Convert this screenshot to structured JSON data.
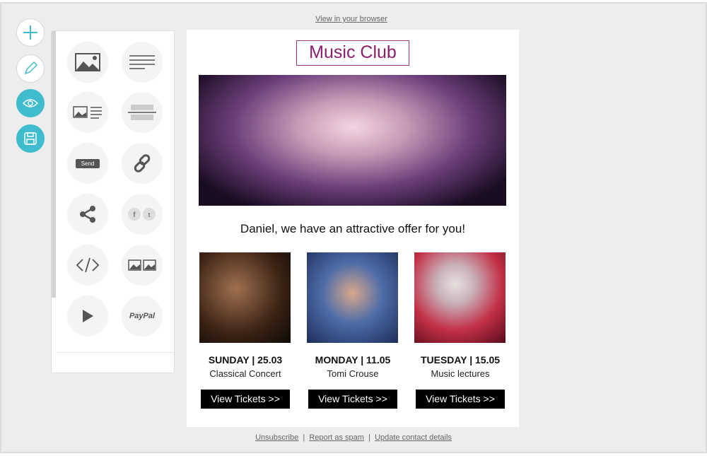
{
  "header": {
    "view_browser": "View in your browser"
  },
  "tools": [
    {
      "icon": "plus-icon"
    },
    {
      "icon": "pencil-icon"
    },
    {
      "icon": "eye-icon",
      "active": true
    },
    {
      "icon": "save-icon",
      "active": true
    }
  ],
  "blocks": [
    "image-block",
    "text-block",
    "image-text-block",
    "divider-block",
    "button-block",
    "link-block",
    "share-block",
    "social-block",
    "html-block",
    "gallery-block",
    "video-block",
    "paypal-block"
  ],
  "blocks_text": {
    "send": "Send",
    "paypal": "PayPal"
  },
  "accent": "#3fbccd",
  "email": {
    "logo": "Music Club",
    "headline": "Daniel, we have an attractive offer for you!",
    "cards": [
      {
        "date": "SUNDAY | 25.03",
        "title": "Classical Concert",
        "button": "View Tickets >>"
      },
      {
        "date": "MONDAY | 11.05",
        "title": "Tomi Crouse",
        "button": "View Tickets >>"
      },
      {
        "date": "TUESDAY | 15.05",
        "title": "Music lectures",
        "button": "View Tickets >>"
      }
    ]
  },
  "footer": {
    "links": [
      "Unsubscribe",
      "Report as spam",
      "Update contact details"
    ],
    "separator": "|"
  }
}
